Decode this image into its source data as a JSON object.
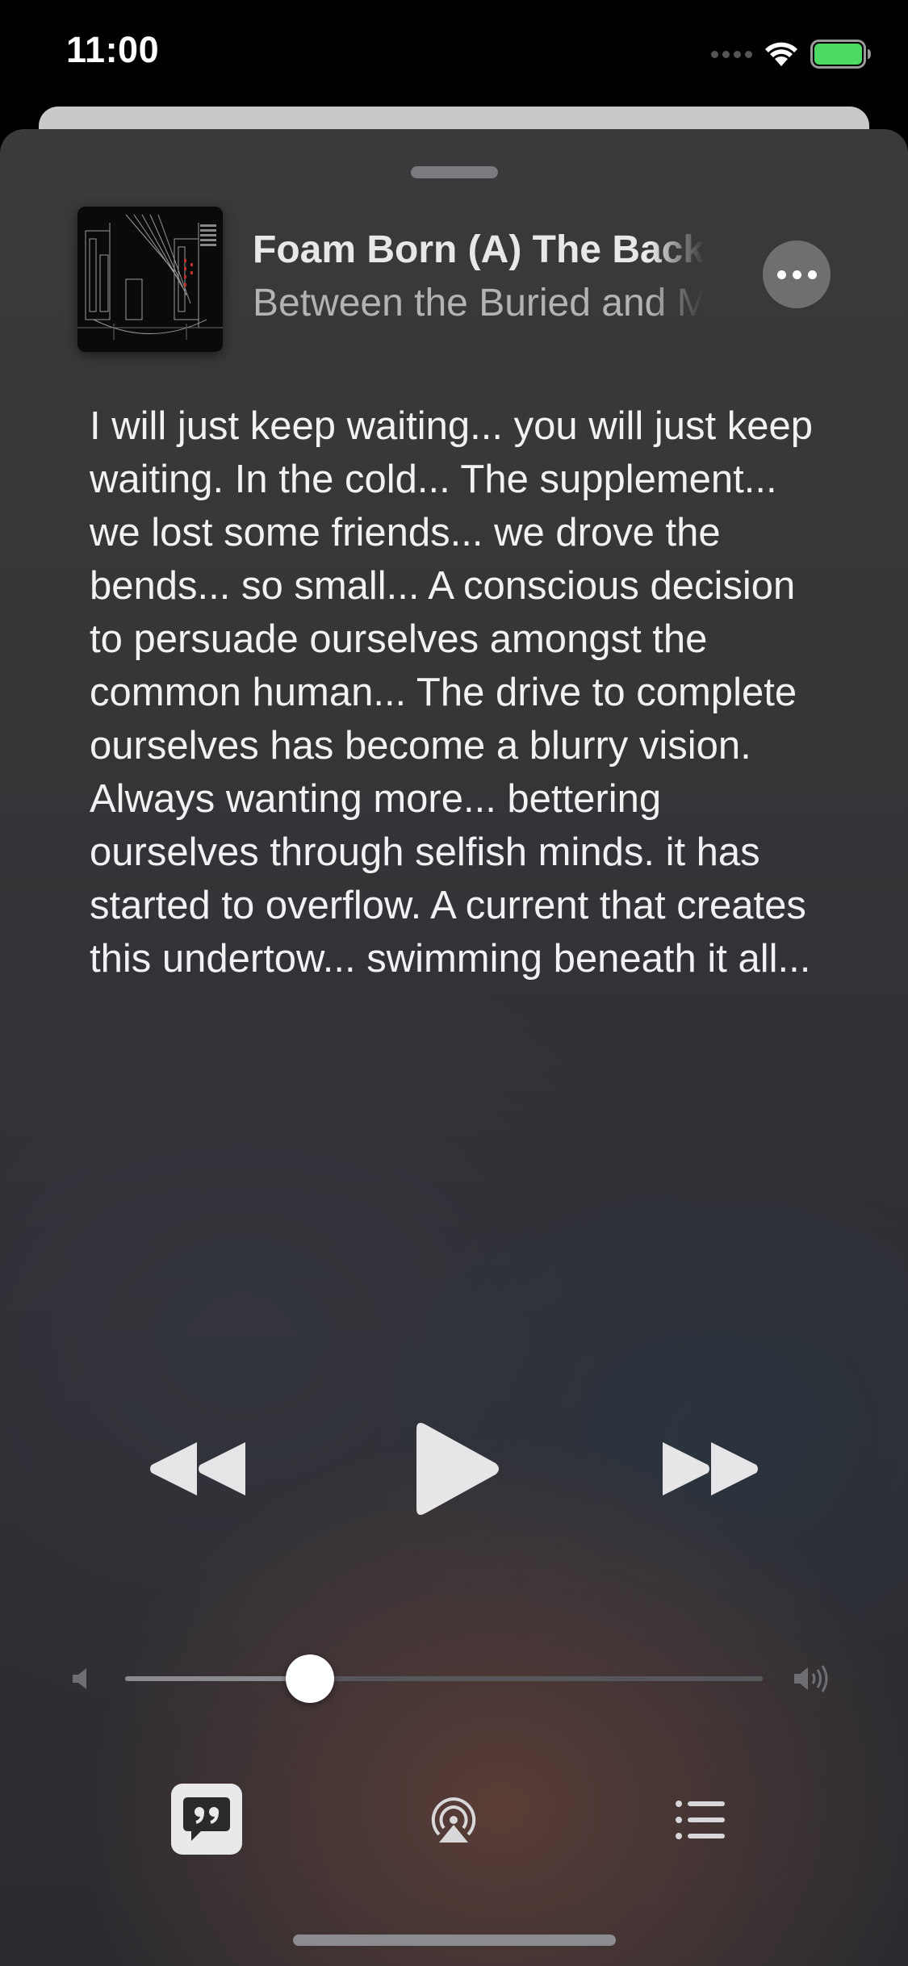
{
  "status_bar": {
    "time": "11:00"
  },
  "now_playing": {
    "title": "Foam Born (A) The Backtrack",
    "artist": "Between the Buried and Me",
    "lyrics": "I will just keep waiting... you will just keep waiting. In the cold... The supplement... we lost some friends... we drove the bends... so small... A conscious decision to persuade ourselves amongst the common human... The drive to complete ourselves has become a blurry vision. Always wanting more... bettering ourselves through selfish minds. it has started to overflow. A current that creates this undertow... swimming beneath it all..."
  },
  "volume": {
    "level": 0.29
  },
  "icons": {
    "rewind": "rewind-icon",
    "play": "play-icon",
    "forward": "fast-forward-icon",
    "lyrics": "lyrics-quote-icon",
    "airplay": "airplay-icon",
    "queue": "queue-list-icon",
    "more": "more-ellipsis-icon",
    "volume_low": "speaker-low-icon",
    "volume_high": "speaker-high-icon"
  },
  "colors": {
    "battery": "#4cd964",
    "control_icon": "#e6e6e8"
  }
}
